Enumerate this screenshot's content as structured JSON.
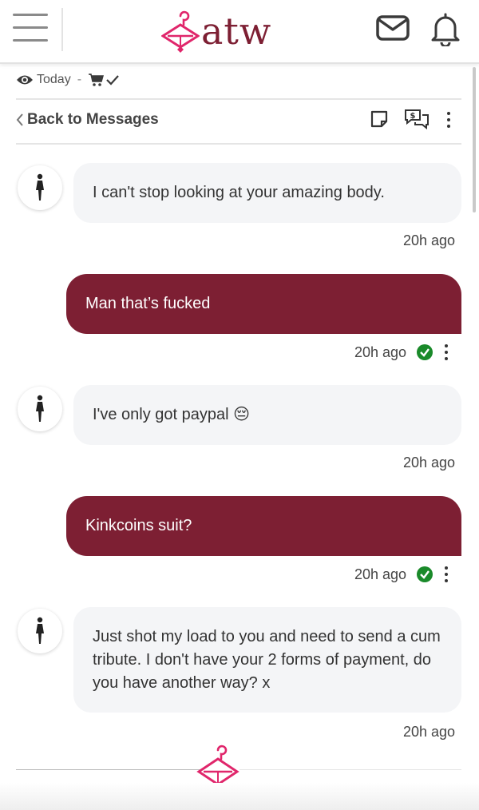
{
  "header": {
    "brand": "atw",
    "icons": {
      "menu": "hamburger-icon",
      "mail": "envelope-icon",
      "notifications": "bell-icon"
    },
    "brand_color": "#7d1f33",
    "accent_color": "#e0266b"
  },
  "status": {
    "label": "Today",
    "separator": "-"
  },
  "toolbar": {
    "back_label": "Back to Messages"
  },
  "messages": [
    {
      "direction": "in",
      "text": "I can't stop looking at your amazing body.",
      "time": "20h ago"
    },
    {
      "direction": "out",
      "text": "Man that’s fucked",
      "time": "20h ago"
    },
    {
      "direction": "in",
      "text": "I've only got paypal 😔",
      "time": "20h ago"
    },
    {
      "direction": "out",
      "text": "Kinkcoins suit?",
      "time": "20h ago"
    },
    {
      "direction": "in",
      "text": "Just shot my load to you and need to send a cum tribute. I don't have your 2 forms of payment, do you have another way? x",
      "time": "20h ago"
    }
  ],
  "colors": {
    "outgoing_bubble": "#7d1f33",
    "incoming_bubble": "#f4f5f7",
    "read_check": "#1a8a2a"
  }
}
